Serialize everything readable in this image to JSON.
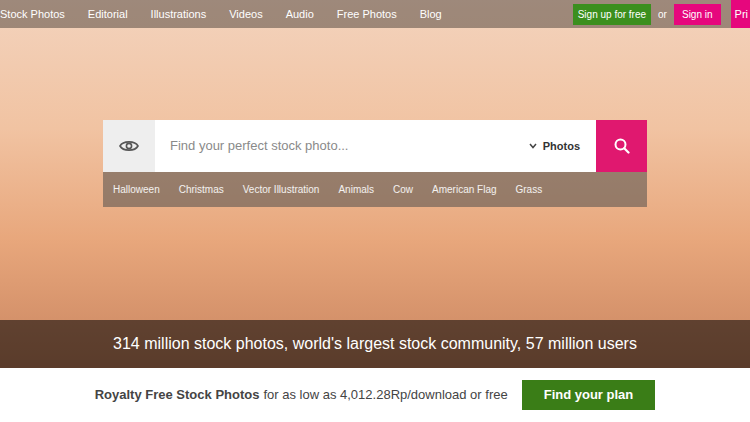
{
  "nav": {
    "items": [
      {
        "label": "Stock Photos"
      },
      {
        "label": "Editorial"
      },
      {
        "label": "Illustrations"
      },
      {
        "label": "Videos"
      },
      {
        "label": "Audio"
      },
      {
        "label": "Free Photos"
      },
      {
        "label": "Blog"
      }
    ],
    "signup": "Sign up for free",
    "or": "or",
    "signin": "Sign in",
    "cut_button": "Pri"
  },
  "search": {
    "placeholder": "Find your perfect stock photo...",
    "type": "Photos"
  },
  "tags": [
    "Halloween",
    "Christmas",
    "Vector Illustration",
    "Animals",
    "Cow",
    "American Flag",
    "Grass"
  ],
  "banner": "314 million stock photos, world's largest stock community, 57 million users",
  "pricing": {
    "strong": "Royalty Free Stock Photos",
    "text": "for as low as 4,012.28Rp/download or free",
    "button": "Find your plan"
  }
}
